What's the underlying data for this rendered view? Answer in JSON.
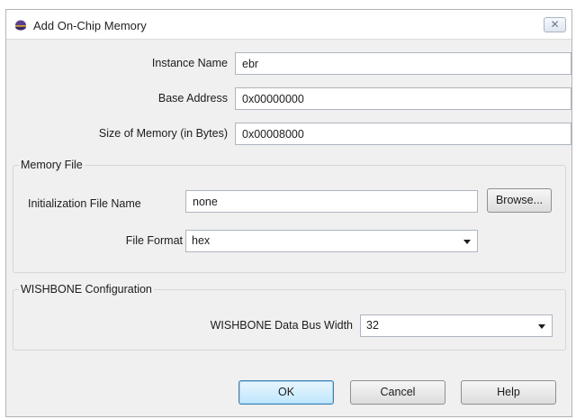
{
  "window": {
    "title": "Add On-Chip Memory",
    "close_glyph": "✕"
  },
  "fields": {
    "instance_name": {
      "label": "Instance Name",
      "value": "ebr"
    },
    "base_address": {
      "label": "Base Address",
      "value": "0x00000000"
    },
    "size": {
      "label": "Size of Memory (in Bytes)",
      "value": "0x00008000"
    }
  },
  "memory_file": {
    "title": "Memory File",
    "init_label": "Initialization File Name",
    "init_value": "none",
    "browse_label": "Browse...",
    "format_label": "File Format",
    "format_value": "hex"
  },
  "wishbone": {
    "title": "WISHBONE Configuration",
    "bus_width_label": "WISHBONE Data Bus Width",
    "bus_width_value": "32"
  },
  "buttons": {
    "ok": "OK",
    "cancel": "Cancel",
    "help": "Help"
  },
  "colors": {
    "icon_purple": "#5b3f8f",
    "icon_yellow": "#d9a520",
    "default_border": "#3c7fb1"
  }
}
